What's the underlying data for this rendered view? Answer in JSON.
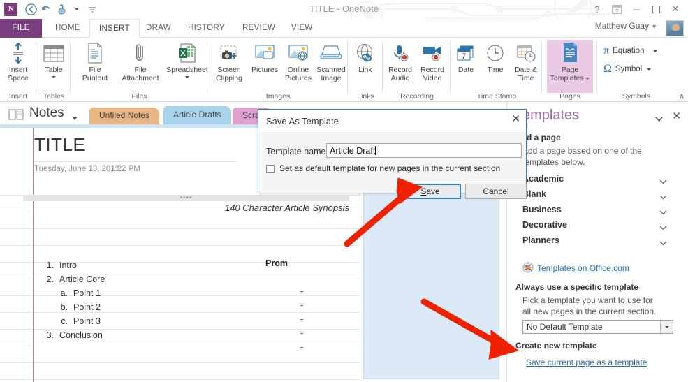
{
  "titlebar": {
    "app_title": "TITLE - OneNote",
    "logo_text": "N",
    "qat": [
      {
        "name": "back-icon",
        "label": "Back"
      },
      {
        "name": "undo-icon",
        "label": "Undo"
      },
      {
        "name": "touch-mode-icon",
        "label": "Touch/Mouse Mode"
      },
      {
        "name": "customize-qat-icon",
        "label": "Customize Quick Access Toolbar"
      }
    ],
    "help_label": "?",
    "ribbon_display_label": "Ribbon Display Options",
    "minimize_label": "─",
    "restore_label": "❐",
    "close_label": "✕",
    "account_name": "Matthew Guay"
  },
  "ribbon_tabs": [
    {
      "label": "FILE",
      "active": false,
      "file": true
    },
    {
      "label": "HOME",
      "active": false
    },
    {
      "label": "INSERT",
      "active": true
    },
    {
      "label": "DRAW",
      "active": false
    },
    {
      "label": "HISTORY",
      "active": false
    },
    {
      "label": "REVIEW",
      "active": false
    },
    {
      "label": "VIEW",
      "active": false
    }
  ],
  "ribbon": {
    "groups": [
      {
        "label": "Insert",
        "buttons": [
          {
            "label1": "Insert",
            "label2": "Space",
            "icon": "insert-space-icon"
          }
        ]
      },
      {
        "label": "Tables",
        "buttons": [
          {
            "label1": "Table",
            "label2": "",
            "icon": "table-icon",
            "dropdown": true
          }
        ]
      },
      {
        "label": "Files",
        "buttons": [
          {
            "label1": "File",
            "label2": "Printout",
            "icon": "file-printout-icon"
          },
          {
            "label1": "File",
            "label2": "Attachment",
            "icon": "file-attachment-icon"
          },
          {
            "label1": "Spreadsheet",
            "label2": "",
            "icon": "spreadsheet-icon",
            "dropdown": true
          }
        ]
      },
      {
        "label": "Images",
        "buttons": [
          {
            "label1": "Screen",
            "label2": "Clipping",
            "icon": "screen-clipping-icon"
          },
          {
            "label1": "Pictures",
            "label2": "",
            "icon": "pictures-icon"
          },
          {
            "label1": "Online",
            "label2": "Pictures",
            "icon": "online-pictures-icon"
          },
          {
            "label1": "Scanned",
            "label2": "Image",
            "icon": "scanned-image-icon"
          }
        ]
      },
      {
        "label": "Links",
        "buttons": [
          {
            "label1": "Link",
            "label2": "",
            "icon": "link-icon"
          }
        ]
      },
      {
        "label": "Recording",
        "buttons": [
          {
            "label1": "Record",
            "label2": "Audio",
            "icon": "record-audio-icon"
          },
          {
            "label1": "Record",
            "label2": "Video",
            "icon": "record-video-icon"
          }
        ]
      },
      {
        "label": "Time Stamp",
        "buttons": [
          {
            "label1": "Date",
            "label2": "",
            "icon": "date-icon"
          },
          {
            "label1": "Time",
            "label2": "",
            "icon": "time-icon"
          },
          {
            "label1": "Date &",
            "label2": "Time",
            "icon": "date-time-icon"
          }
        ]
      },
      {
        "label": "Pages",
        "buttons": [
          {
            "label1": "Page",
            "label2": "Templates",
            "icon": "page-templates-icon",
            "highlighted": true,
            "dropdown": true
          }
        ]
      },
      {
        "label": "Symbols",
        "small": [
          {
            "label": "Equation",
            "icon": "equation-pi-icon",
            "glyph": "π",
            "dropdown": true
          },
          {
            "label": "Symbol",
            "icon": "symbol-omega-icon",
            "glyph": "Ω",
            "dropdown": true
          }
        ]
      }
    ],
    "collapse_label": "∧"
  },
  "nav": {
    "notebook_name": "Notes",
    "notebook_icon": "notebook-icon",
    "sections": [
      {
        "label": "Unfiled Notes",
        "color": "#e8b584",
        "active": false
      },
      {
        "label": "Article Drafts",
        "color": "#a8d3ed",
        "active": true
      },
      {
        "label": "Scrat",
        "color": "#e0a0cf",
        "active": false
      }
    ]
  },
  "page": {
    "title": "TITLE",
    "date": "Tuesday, June 13, 2017",
    "time": "1:22 PM",
    "synopsis": "140 Character Article Synopsis",
    "outline": [
      {
        "num": "1.",
        "text": "Intro",
        "level": 1
      },
      {
        "num": "2.",
        "text": "Article Core",
        "level": 1
      },
      {
        "num": "a.",
        "text": "Point 1",
        "level": 2
      },
      {
        "num": "b.",
        "text": "Point 2",
        "level": 2
      },
      {
        "num": "c.",
        "text": "Point 3",
        "level": 2
      },
      {
        "num": "3.",
        "text": "Conclusion",
        "level": 1
      }
    ],
    "right_column_label": "Prom",
    "dashes": [
      "-",
      "-",
      "-",
      "-",
      "-"
    ]
  },
  "taskpane": {
    "title": "Templates",
    "caret_label": "▾",
    "close_label": "✕",
    "add_page_heading": "Add a page",
    "add_page_desc": "Add a page based on one of the templates below.",
    "categories": [
      {
        "label": "Academic"
      },
      {
        "label": "Blank"
      },
      {
        "label": "Business"
      },
      {
        "label": "Decorative"
      },
      {
        "label": "Planners"
      }
    ],
    "office_link": "Templates on Office.com",
    "always_heading": "Always use a specific template",
    "always_desc": "Pick a template you want to use for all new pages in the current section.",
    "default_template_value": "No Default Template",
    "create_heading": "Create new template",
    "create_link": "Save current page as a template"
  },
  "dialog": {
    "title": "Save As Template",
    "close_label": "✕",
    "name_label": "Template name:",
    "name_value": "Article Draft",
    "checkbox_label": "Set as default template for new pages in the current section",
    "checkbox_checked": false,
    "save_label": "Save",
    "save_accel": "S",
    "cancel_label": "Cancel"
  },
  "annotations": {
    "arrow_color": "#ee2200",
    "arrow1_target": "save-button",
    "arrow2_target": "save-current-page-as-template-link"
  }
}
